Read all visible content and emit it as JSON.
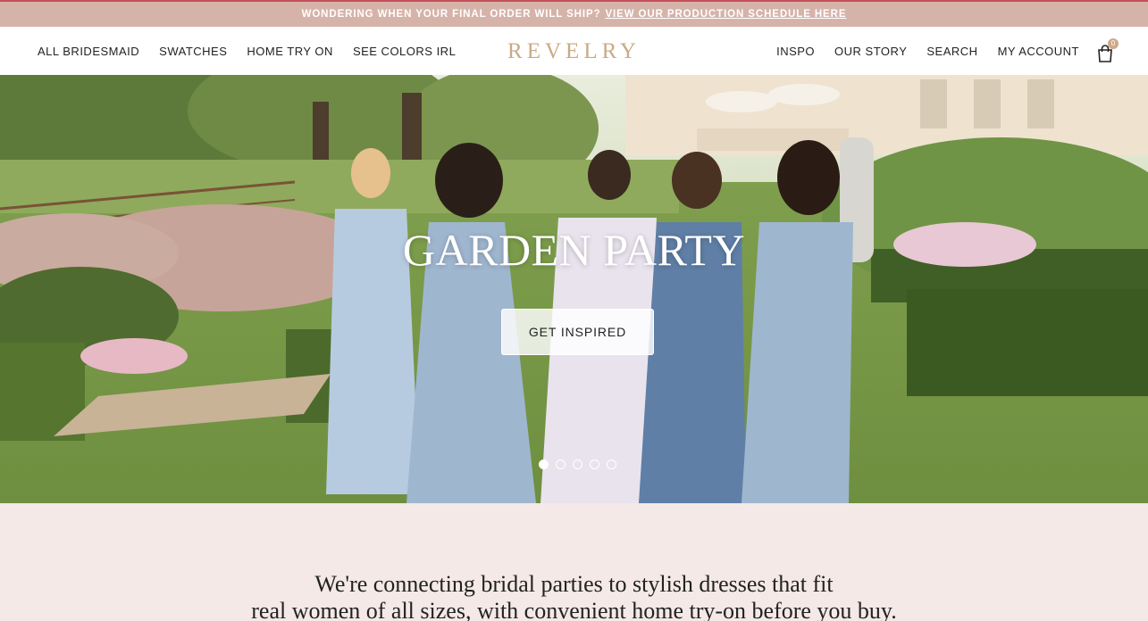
{
  "announcement": {
    "text": "WONDERING WHEN YOUR FINAL ORDER WILL SHIP?",
    "link": "VIEW OUR PRODUCTION SCHEDULE HERE"
  },
  "header": {
    "logo": "REVELRY",
    "nav_left": [
      "ALL BRIDESMAID",
      "SWATCHES",
      "HOME TRY ON",
      "SEE COLORS IRL"
    ],
    "nav_right": [
      "INSPO",
      "OUR STORY",
      "SEARCH",
      "MY ACCOUNT"
    ],
    "cart_count": "0",
    "cart_icon": "shopping-bag-icon"
  },
  "hero": {
    "title": "GARDEN PARTY",
    "button": "GET INSPIRED",
    "slides_total": 5,
    "active_slide": 1
  },
  "mission": {
    "line1": "We're connecting bridal parties to stylish dresses that fit",
    "line2": "real women of all sizes, with convenient home try-on before you buy."
  },
  "colors": {
    "announce_bg": "#d6b3a9",
    "logo": "#c9aa85",
    "page_bg": "#f4e9e6"
  }
}
